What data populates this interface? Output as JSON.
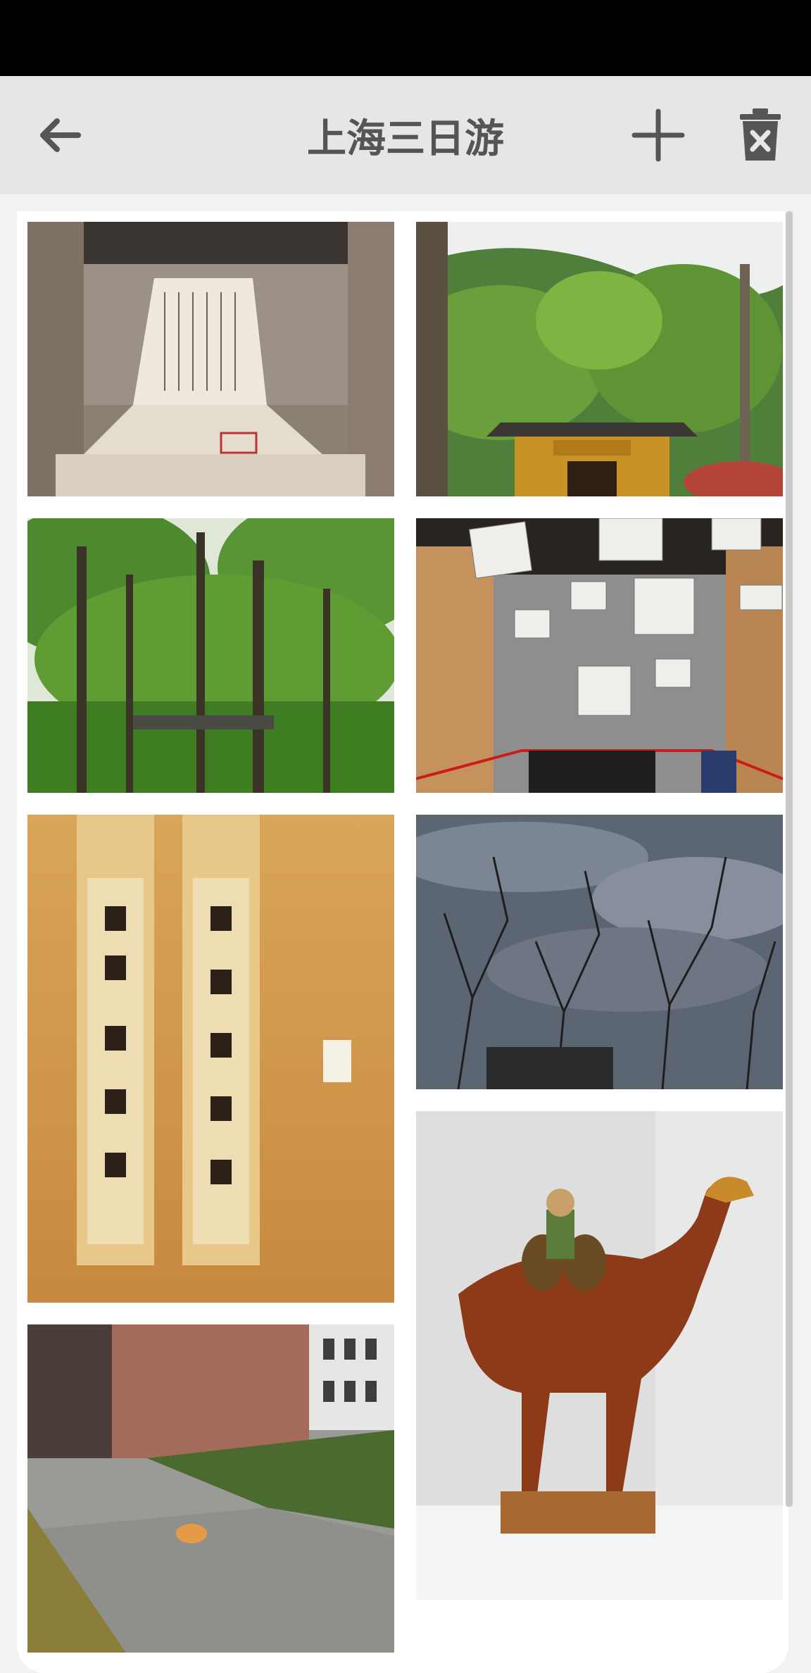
{
  "toolbar": {
    "title": "上海三日游"
  },
  "icons": {
    "back": "back-arrow-icon",
    "add": "plus-icon",
    "delete": "trash-icon"
  },
  "photos": [
    {
      "name": "calligraphy-exhibit-photo"
    },
    {
      "name": "temple-gate-forest-photo"
    },
    {
      "name": "tall-trees-forest-photo"
    },
    {
      "name": "newspaper-exhibit-photo"
    },
    {
      "name": "calligraphy-scroll-photo"
    },
    {
      "name": "bare-trees-sky-photo"
    },
    {
      "name": "tang-camel-statue-photo"
    },
    {
      "name": "courtyard-cat-photo"
    }
  ]
}
